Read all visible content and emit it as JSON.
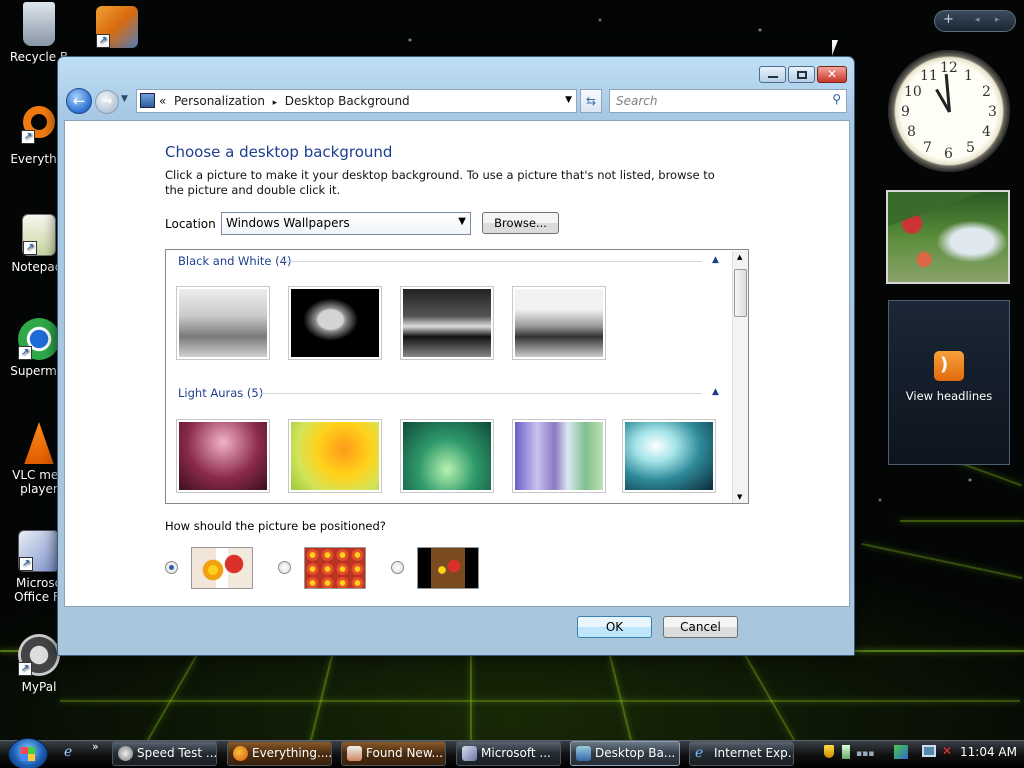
{
  "desktop": {
    "icons": [
      {
        "label": "Recycle B"
      },
      {
        "label": "Everythin"
      },
      {
        "label": "Notepad-"
      },
      {
        "label": "Supermiu"
      },
      {
        "label": "VLC med player"
      },
      {
        "label": "Microso Office Fr"
      },
      {
        "label": "MyPal"
      }
    ]
  },
  "gadgets": {
    "toolbar_add": "+",
    "clock_numbers": [
      "12",
      "1",
      "2",
      "3",
      "4",
      "5",
      "6",
      "7",
      "8",
      "9",
      "10",
      "11"
    ],
    "feed_label": "View headlines"
  },
  "window": {
    "address": {
      "root": "«",
      "crumb1": "Personalization",
      "separator": "▸",
      "crumb2": "Desktop Background"
    },
    "search_placeholder": "Search",
    "heading": "Choose a desktop background",
    "instructions": "Click a picture to make it your desktop background. To use a picture that's not listed, browse to the picture and double click it.",
    "location_label": "Location",
    "location_value": "Windows Wallpapers",
    "browse_label": "Browse...",
    "groups": [
      {
        "title": "Black and White (4)"
      },
      {
        "title": "Light Auras (5)"
      }
    ],
    "position_question": "How should the picture be positioned?",
    "positions": [
      "fit",
      "tile",
      "center"
    ],
    "selected_position": "fit",
    "ok_label": "OK",
    "cancel_label": "Cancel"
  },
  "taskbar": {
    "quick_more": "»",
    "tasks": [
      {
        "label": "Speed Test ..."
      },
      {
        "label": "Everything...."
      },
      {
        "label": "Found New..."
      },
      {
        "label": "Microsoft ..."
      },
      {
        "label": "Desktop Ba..."
      },
      {
        "label": "Internet Exp..."
      }
    ],
    "time": "11:04 AM"
  },
  "colors": {
    "accent": "#1c3d8f",
    "grid": "#8fd01a"
  }
}
